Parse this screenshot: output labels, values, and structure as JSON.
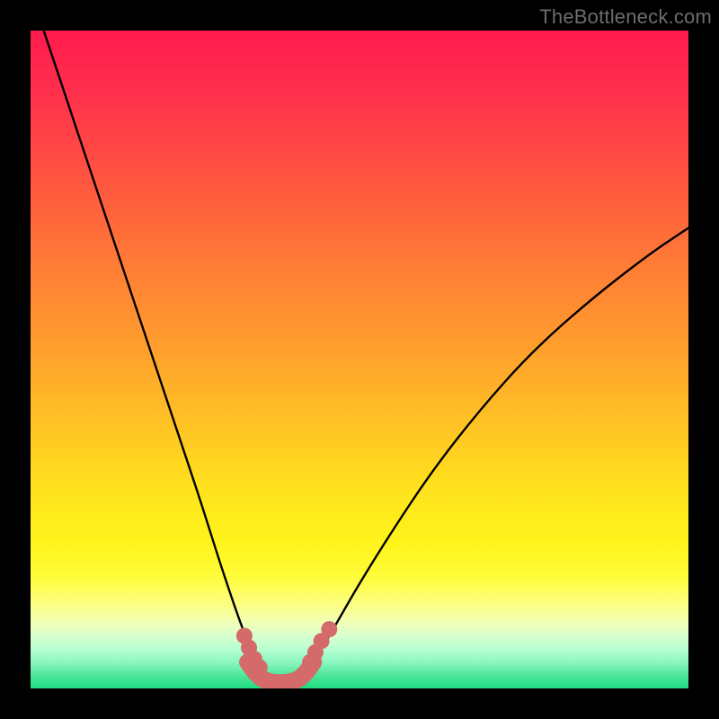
{
  "watermark": "TheBottleneck.com",
  "chart_data": {
    "type": "line",
    "title": "",
    "xlabel": "",
    "ylabel": "",
    "xlim": [
      0,
      100
    ],
    "ylim": [
      0,
      100
    ],
    "grid": false,
    "series": [
      {
        "name": "left-curve",
        "x": [
          2,
          5,
          8,
          11,
          14,
          17,
          20,
          23,
          26,
          28.5,
          31,
          33,
          34.5,
          36,
          37
        ],
        "values": [
          100,
          91,
          82,
          73,
          64,
          55,
          46,
          37,
          28,
          20,
          12.5,
          7,
          4,
          1.8,
          0.5
        ],
        "color": "#000000"
      },
      {
        "name": "flat-bottom",
        "x": [
          34.5,
          36,
          38,
          40,
          41.5
        ],
        "values": [
          0.9,
          0.4,
          0.3,
          0.4,
          0.9
        ],
        "color": "#000000"
      },
      {
        "name": "right-curve",
        "x": [
          41,
          43,
          46,
          50,
          55,
          61,
          68,
          76,
          85,
          94,
          100
        ],
        "values": [
          1.5,
          4,
          9,
          16,
          24,
          33,
          42,
          51,
          59,
          66,
          70
        ],
        "color": "#000000"
      },
      {
        "name": "dots-left",
        "type": "scatter",
        "x": [
          32.5,
          33.2,
          34.0,
          34.8
        ],
        "values": [
          8.0,
          6.2,
          4.5,
          3.2
        ],
        "color": "#d46a6a"
      },
      {
        "name": "dots-right",
        "type": "scatter",
        "x": [
          42.5,
          43.3,
          44.2,
          45.4
        ],
        "values": [
          4.0,
          5.5,
          7.2,
          9.0
        ],
        "color": "#d46a6a"
      },
      {
        "name": "bottom-band",
        "type": "area",
        "x": [
          33,
          34,
          35,
          36,
          37,
          38,
          39,
          40,
          41,
          42,
          43
        ],
        "values": [
          4.0,
          2.6,
          1.6,
          1.1,
          0.9,
          0.85,
          0.9,
          1.1,
          1.6,
          2.6,
          4.0
        ],
        "color": "#d46a6a"
      }
    ]
  }
}
